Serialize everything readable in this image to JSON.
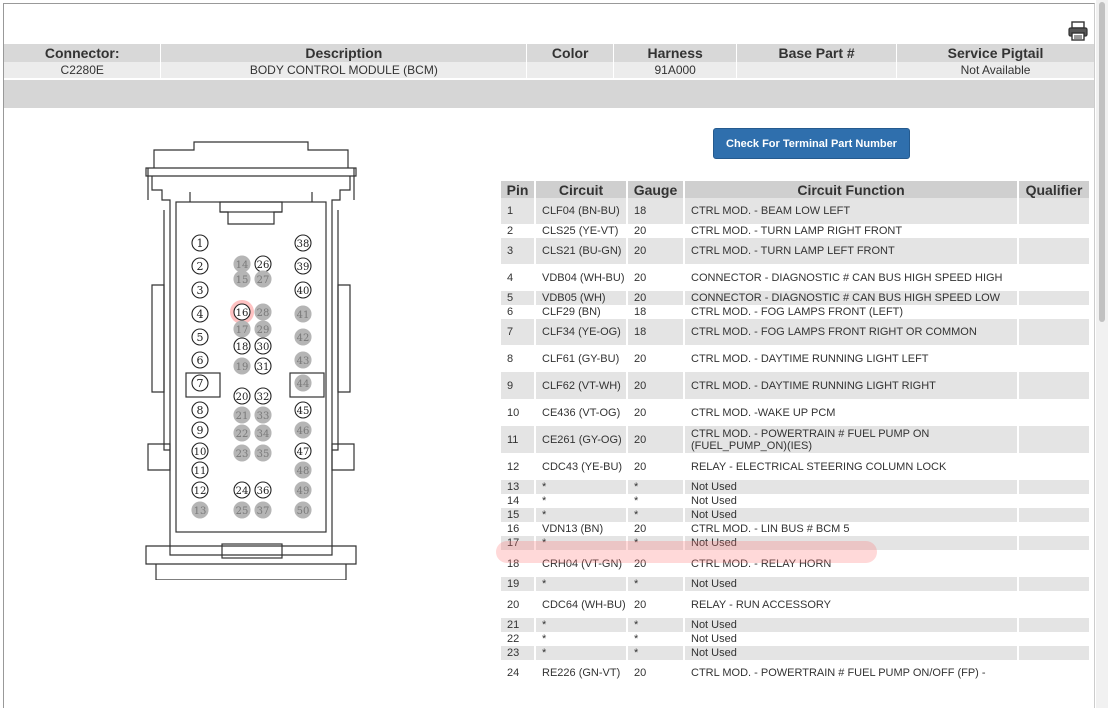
{
  "header": {
    "columns": [
      "Connector:",
      "Description",
      "Color",
      "Harness",
      "Base Part #",
      "Service Pigtail"
    ],
    "values": [
      "C2280E",
      "BODY CONTROL MODULE (BCM)",
      "",
      "91A000",
      "",
      "Not Available"
    ]
  },
  "button": {
    "label": "Check For Terminal Part Number"
  },
  "icons": {
    "print": "printer-icon"
  },
  "highlight_color": "#ff7878",
  "diagram": {
    "pins_outline": [
      "1",
      "2",
      "3",
      "4",
      "5",
      "6",
      "7",
      "8",
      "9",
      "10",
      "11",
      "12",
      "16",
      "18",
      "20",
      "24",
      "26",
      "30",
      "31",
      "32",
      "36",
      "38",
      "39",
      "40",
      "45",
      "47"
    ],
    "pins_gray": [
      "13",
      "14",
      "15",
      "17",
      "19",
      "21",
      "22",
      "23",
      "25",
      "27",
      "28",
      "29",
      "33",
      "34",
      "35",
      "37",
      "41",
      "42",
      "43",
      "44",
      "46",
      "48",
      "49",
      "50"
    ],
    "highlighted_pin": "16"
  },
  "pin_table": {
    "columns": [
      "Pin",
      "Circuit",
      "Gauge",
      "Circuit Function",
      "Qualifier"
    ],
    "rows": [
      {
        "pin": "1",
        "circuit": "CLF04 (BN-BU)",
        "gauge": "18",
        "function": "CTRL MOD. - BEAM LOW LEFT",
        "qualifier": ""
      },
      {
        "pin": "2",
        "circuit": "CLS25 (YE-VT)",
        "gauge": "20",
        "function": "CTRL MOD. - TURN LAMP RIGHT FRONT",
        "qualifier": ""
      },
      {
        "pin": "3",
        "circuit": "CLS21 (BU-GN)",
        "gauge": "20",
        "function": "CTRL MOD. - TURN LAMP LEFT FRONT",
        "qualifier": ""
      },
      {
        "pin": "4",
        "circuit": "VDB04 (WH-BU)",
        "gauge": "20",
        "function": "CONNECTOR - DIAGNOSTIC # CAN BUS HIGH SPEED HIGH",
        "qualifier": ""
      },
      {
        "pin": "5",
        "circuit": "VDB05 (WH)",
        "gauge": "20",
        "function": "CONNECTOR - DIAGNOSTIC # CAN BUS HIGH SPEED LOW",
        "qualifier": ""
      },
      {
        "pin": "6",
        "circuit": "CLF29 (BN)",
        "gauge": "18",
        "function": "CTRL MOD. - FOG LAMPS FRONT (LEFT)",
        "qualifier": ""
      },
      {
        "pin": "7",
        "circuit": "CLF34 (YE-OG)",
        "gauge": "18",
        "function": "CTRL MOD. - FOG LAMPS FRONT RIGHT OR COMMON",
        "qualifier": ""
      },
      {
        "pin": "8",
        "circuit": "CLF61 (GY-BU)",
        "gauge": "20",
        "function": "CTRL MOD. - DAYTIME RUNNING LIGHT LEFT",
        "qualifier": ""
      },
      {
        "pin": "9",
        "circuit": "CLF62 (VT-WH)",
        "gauge": "20",
        "function": "CTRL MOD. - DAYTIME RUNNING LIGHT RIGHT",
        "qualifier": ""
      },
      {
        "pin": "10",
        "circuit": "CE436 (VT-OG)",
        "gauge": "20",
        "function": "CTRL MOD. -WAKE UP PCM",
        "qualifier": ""
      },
      {
        "pin": "11",
        "circuit": "CE261 (GY-OG)",
        "gauge": "20",
        "function": "CTRL MOD. - POWERTRAIN # FUEL PUMP ON (FUEL_PUMP_ON)(IES)",
        "qualifier": ""
      },
      {
        "pin": "12",
        "circuit": "CDC43 (YE-BU)",
        "gauge": "20",
        "function": "RELAY - ELECTRICAL STEERING COLUMN LOCK",
        "qualifier": ""
      },
      {
        "pin": "13",
        "circuit": "*",
        "gauge": "*",
        "function": "Not Used",
        "qualifier": ""
      },
      {
        "pin": "14",
        "circuit": "*",
        "gauge": "*",
        "function": "Not Used",
        "qualifier": ""
      },
      {
        "pin": "15",
        "circuit": "*",
        "gauge": "*",
        "function": "Not Used",
        "qualifier": ""
      },
      {
        "pin": "16",
        "circuit": "VDN13 (BN)",
        "gauge": "20",
        "function": "CTRL MOD. - LIN BUS # BCM 5",
        "qualifier": ""
      },
      {
        "pin": "17",
        "circuit": "*",
        "gauge": "*",
        "function": "Not Used",
        "qualifier": ""
      },
      {
        "pin": "18",
        "circuit": "CRH04 (VT-GN)",
        "gauge": "20",
        "function": "CTRL MOD. - RELAY HORN",
        "qualifier": ""
      },
      {
        "pin": "19",
        "circuit": "*",
        "gauge": "*",
        "function": "Not Used",
        "qualifier": ""
      },
      {
        "pin": "20",
        "circuit": "CDC64 (WH-BU)",
        "gauge": "20",
        "function": "RELAY - RUN ACCESSORY",
        "qualifier": ""
      },
      {
        "pin": "21",
        "circuit": "*",
        "gauge": "*",
        "function": "Not Used",
        "qualifier": ""
      },
      {
        "pin": "22",
        "circuit": "*",
        "gauge": "*",
        "function": "Not Used",
        "qualifier": ""
      },
      {
        "pin": "23",
        "circuit": "*",
        "gauge": "*",
        "function": "Not Used",
        "qualifier": ""
      },
      {
        "pin": "24",
        "circuit": "RE226 (GN-VT)",
        "gauge": "20",
        "function": "CTRL MOD. - POWERTRAIN # FUEL PUMP ON/OFF (FP) -",
        "qualifier": ""
      }
    ]
  }
}
